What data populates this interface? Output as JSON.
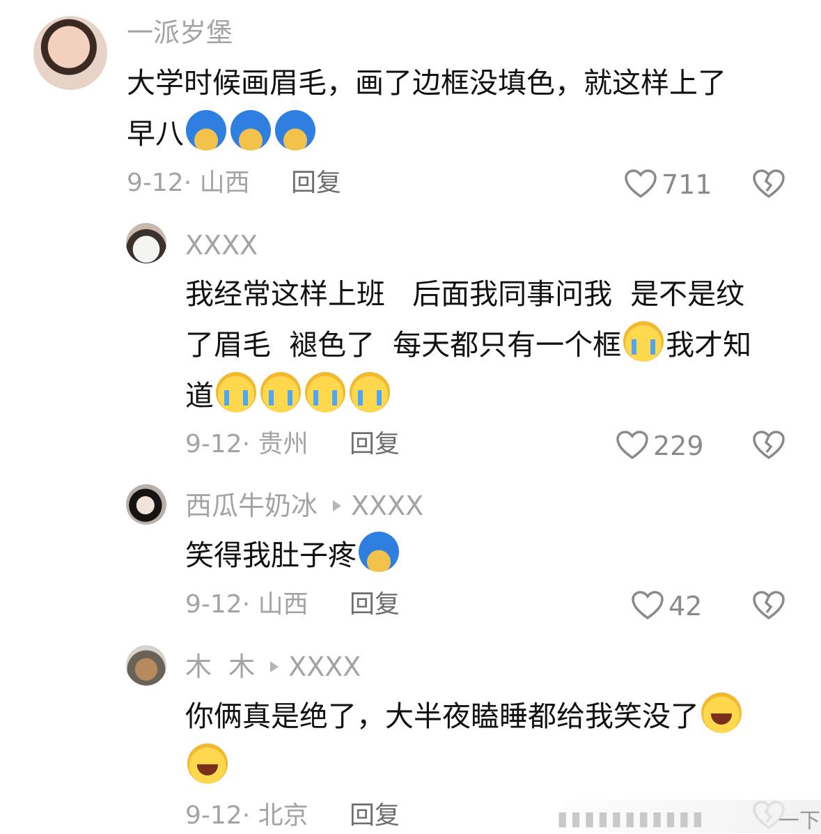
{
  "comments": [
    {
      "username": "一派岁堡",
      "text_line1": "大学时候画眉毛，画了边框没填色，就这样上了",
      "text_line2": "早八",
      "date": "9-12",
      "location": "山西",
      "reply_label": "回复",
      "likes": "711"
    },
    {
      "username": "XXXX",
      "text_line1": "我经常这样上班   后面我同事问我  是不是纹",
      "text_line2": "了眉毛  褪色了  每天都只有一个框",
      "text_line2_tail": "我才知",
      "text_line3": "道",
      "date": "9-12",
      "location": "贵州",
      "reply_label": "回复",
      "likes": "229"
    },
    {
      "username": "西瓜牛奶冰",
      "reply_to": "XXXX",
      "text_line1": "笑得我肚子疼",
      "date": "9-12",
      "location": "山西",
      "reply_label": "回复",
      "likes": "42"
    },
    {
      "username": "木  木",
      "reply_to": "XXXX",
      "text_line1": "你俩真是绝了，大半夜瞌睡都给我笑没了",
      "date": "9-12",
      "location": "北京",
      "reply_label": "回复"
    }
  ],
  "footer": {
    "label": "一下"
  },
  "icons": {
    "like": "heart-outline-icon",
    "dislike": "broken-heart-icon",
    "reply_arrow": "triangle-right-icon"
  },
  "colors": {
    "username": "#a3a3a3",
    "text": "#111111",
    "meta": "#a3a3a3",
    "reply": "#6e6e6e"
  }
}
